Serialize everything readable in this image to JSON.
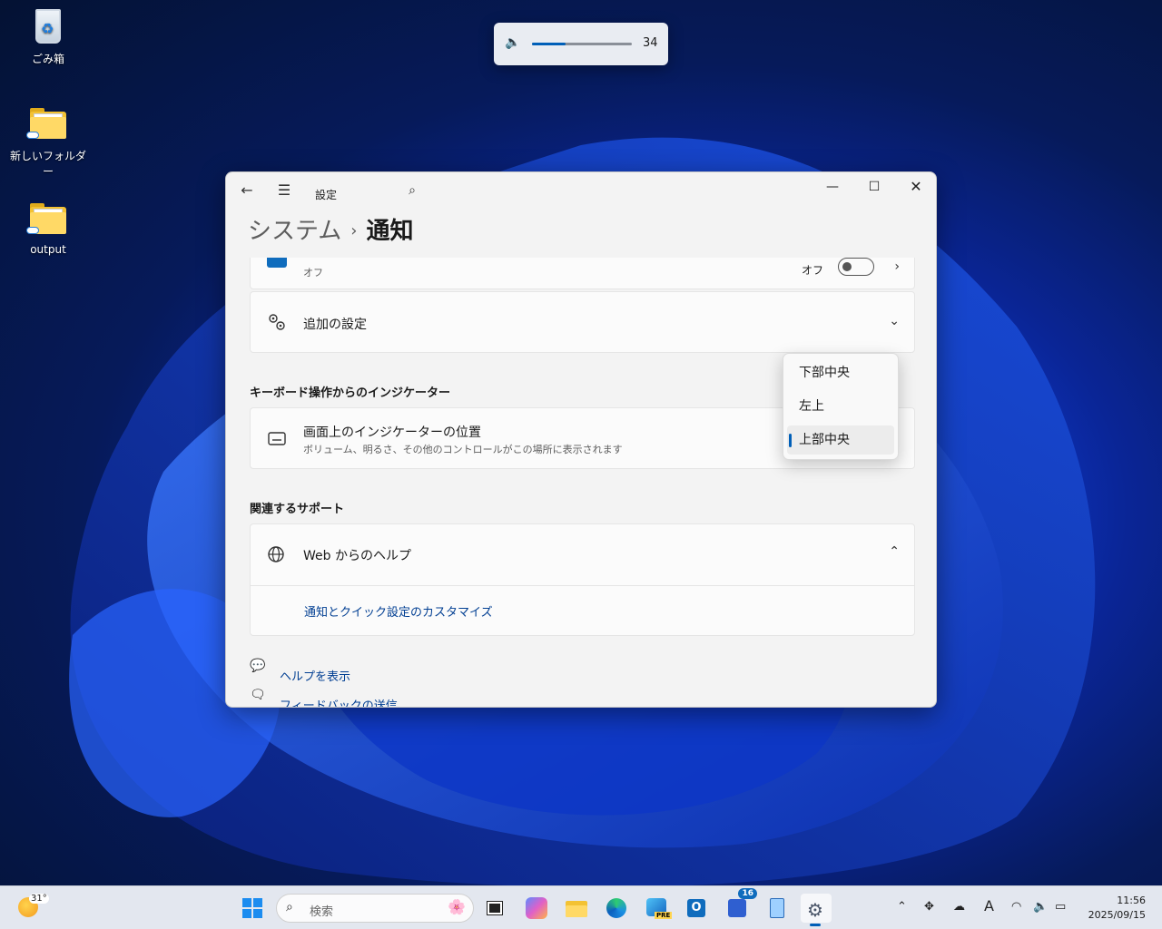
{
  "desktop": {
    "icons": [
      {
        "label": "ごみ箱"
      },
      {
        "label": "新しいフォルダー"
      },
      {
        "label": "output"
      }
    ]
  },
  "volume_flyout": {
    "value": "34",
    "level_percent": 34,
    "icon": "speaker-icon"
  },
  "window": {
    "app_title": "設定",
    "breadcrumb": {
      "parent": "システム",
      "separator": "›",
      "current": "通知"
    },
    "partial_card": {
      "desc": "オフ",
      "toggle_label": "オフ"
    },
    "additional_settings": {
      "title": "追加の設定"
    },
    "keyboard_section": {
      "heading": "キーボード操作からのインジケーター",
      "card_title": "画面上のインジケーターの位置",
      "card_desc": "ボリューム、明るさ、その他のコントロールがこの場所に表示されます"
    },
    "support_section": {
      "heading": "関連するサポート",
      "web_help_title": "Web からのヘルプ",
      "web_help_link": "通知とクイック設定のカスタマイズ"
    },
    "footer_links": {
      "help": "ヘルプを表示",
      "feedback": "フィードバックの送信"
    },
    "dropdown": {
      "options": [
        "下部中央",
        "左上",
        "上部中央"
      ],
      "selected": "上部中央"
    }
  },
  "taskbar": {
    "weather_temp": "31°",
    "search_placeholder": "検索",
    "teams_badge": "16",
    "clock_time": "11:56",
    "clock_date": "2025/09/15",
    "ime_label": "A"
  },
  "colors": {
    "accent": "#005fb8",
    "link": "#003e92",
    "window_bg": "#f3f3f3"
  }
}
